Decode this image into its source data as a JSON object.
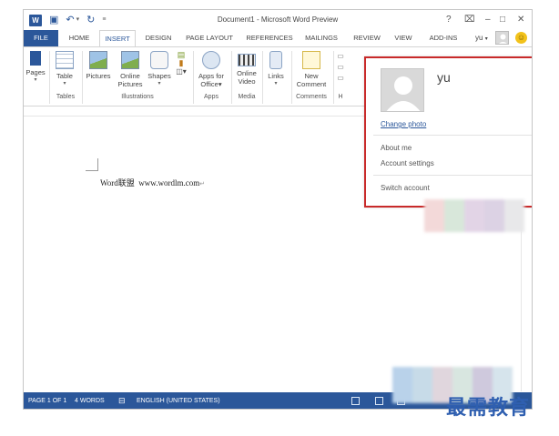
{
  "window": {
    "title": "Document1 - Microsoft Word Preview"
  },
  "quick_access": {
    "word_logo": "W",
    "save_icon": "save-icon",
    "undo_icon": "undo-icon",
    "redo_icon": "redo-icon",
    "customize_icon": "customize-qat-icon"
  },
  "window_controls": {
    "help": "?",
    "restore_ribbon": "⌧",
    "minimize": "–",
    "maximize": "□",
    "close": "✕"
  },
  "tabs": [
    "FILE",
    "HOME",
    "INSERT",
    "DESIGN",
    "PAGE LAYOUT",
    "REFERENCES",
    "MAILINGS",
    "REVIEW",
    "VIEW",
    "ADD-INS"
  ],
  "active_tab": "INSERT",
  "user": {
    "name": "yu",
    "caret": "▾"
  },
  "ribbon": {
    "pages": {
      "label": "Pages",
      "caret": "▾"
    },
    "table": {
      "label": "Table",
      "caret": "▾",
      "group": "Tables"
    },
    "pictures": {
      "label": "Pictures"
    },
    "online_pictures": {
      "label": "Online Pictures",
      "line1": "Online",
      "line2": "Pictures"
    },
    "shapes": {
      "label": "Shapes",
      "caret": "▾"
    },
    "smartart_caret": "▾",
    "illustrations_group": "Illustrations",
    "apps_for_office": {
      "line1": "Apps for",
      "line2": "Office",
      "caret": "▾"
    },
    "apps_group": "Apps",
    "online_video": {
      "line1": "Online",
      "line2": "Video"
    },
    "media_group": "Media",
    "links": {
      "label": "Links",
      "caret": "▾"
    },
    "new_comment": {
      "line1": "New",
      "line2": "Comment"
    },
    "comments_group": "Comments",
    "truncated_group": "H"
  },
  "document": {
    "text_latin": "Word",
    "text_cn": "联盟",
    "text_url": "www.wordlm.com",
    "pilcrow": "↵"
  },
  "account_popup": {
    "name": "yu",
    "change_photo": "Change photo",
    "about_me": "About me",
    "account_settings": "Account settings",
    "switch_account": "Switch account"
  },
  "status_bar": {
    "page": "PAGE 1 OF 1",
    "words": "4 WORDS",
    "language": "ENGLISH (UNITED STATES)"
  },
  "watermark": "最需教育",
  "colors": {
    "accent": "#2b579a",
    "highlight_border": "#c82a2a"
  }
}
